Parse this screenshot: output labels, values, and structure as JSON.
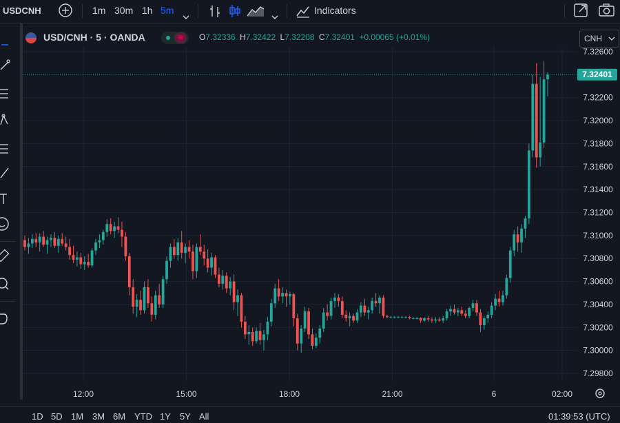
{
  "toolbar": {
    "symbol": "USDCNH",
    "intervals": [
      "1m",
      "30m",
      "1h",
      "5m"
    ],
    "active_interval": "5m",
    "indicators_label": "Indicators"
  },
  "legend": {
    "title": "USD/CNH · 5 · OANDA",
    "o_label": "O",
    "o_value": "7.32336",
    "h_label": "H",
    "h_value": "7.32422",
    "l_label": "L",
    "l_value": "7.32208",
    "c_label": "C",
    "c_value": "7.32401",
    "change": "+0.00065 (+0.01%)"
  },
  "currency_button": "CNH",
  "colors": {
    "up": "#26a69a",
    "down": "#ef5350",
    "bg": "#131722",
    "grid": "#1f2330",
    "text": "#d1d4dc",
    "accent": "#2962ff"
  },
  "price_axis": {
    "labels": [
      "7.32600",
      "7.32200",
      "7.32000",
      "7.31800",
      "7.31600",
      "7.31400",
      "7.31200",
      "7.31000",
      "7.30800",
      "7.30600",
      "7.30400",
      "7.30200",
      "7.30000",
      "7.29800"
    ],
    "current_price": "7.32401"
  },
  "time_axis": {
    "labels": [
      "12:00",
      "15:00",
      "18:00",
      "21:00",
      "6",
      "02:00"
    ]
  },
  "bottom": {
    "ranges": [
      "1D",
      "5D",
      "1M",
      "3M",
      "6M",
      "YTD",
      "1Y",
      "5Y",
      "All"
    ],
    "clock": "01:39:53 (UTC)"
  },
  "chart_data": {
    "type": "candlestick",
    "y_range": [
      7.2978,
      7.3262
    ],
    "x_ticks": [
      "12:00",
      "15:00",
      "18:00",
      "21:00",
      "6",
      "02:00"
    ],
    "last_price": 7.32401,
    "candles": [
      [
        7.3096,
        7.31,
        7.3087,
        7.309
      ],
      [
        7.309,
        7.3098,
        7.3084,
        7.3093
      ],
      [
        7.3093,
        7.3101,
        7.3089,
        7.3097
      ],
      [
        7.3097,
        7.3102,
        7.309,
        7.3094
      ],
      [
        7.3094,
        7.3102,
        7.3086,
        7.3099
      ],
      [
        7.3099,
        7.3104,
        7.309,
        7.3092
      ],
      [
        7.3092,
        7.3099,
        7.3084,
        7.3096
      ],
      [
        7.3096,
        7.3101,
        7.309,
        7.3098
      ],
      [
        7.3098,
        7.3103,
        7.3089,
        7.3091
      ],
      [
        7.3091,
        7.31,
        7.3085,
        7.3097
      ],
      [
        7.3097,
        7.3102,
        7.3091,
        7.3093
      ],
      [
        7.3093,
        7.3099,
        7.3087,
        7.309
      ],
      [
        7.309,
        7.3097,
        7.3079,
        7.3083
      ],
      [
        7.3083,
        7.3091,
        7.3076,
        7.3079
      ],
      [
        7.3079,
        7.3086,
        7.3073,
        7.3081
      ],
      [
        7.3081,
        7.3085,
        7.3071,
        7.3075
      ],
      [
        7.3075,
        7.3082,
        7.307,
        7.3077
      ],
      [
        7.3077,
        7.3084,
        7.3072,
        7.3074
      ],
      [
        7.3074,
        7.3089,
        7.3072,
        7.3087
      ],
      [
        7.3087,
        7.3097,
        7.3083,
        7.3094
      ],
      [
        7.3094,
        7.3101,
        7.3089,
        7.3096
      ],
      [
        7.3096,
        7.3105,
        7.3092,
        7.3103
      ],
      [
        7.3103,
        7.3114,
        7.3099,
        7.311
      ],
      [
        7.311,
        7.3115,
        7.3101,
        7.3104
      ],
      [
        7.3104,
        7.3112,
        7.3098,
        7.3108
      ],
      [
        7.3108,
        7.3116,
        7.3102,
        7.3105
      ],
      [
        7.3105,
        7.3112,
        7.309,
        7.3099
      ],
      [
        7.3099,
        7.3103,
        7.3078,
        7.3082
      ],
      [
        7.3082,
        7.3085,
        7.3048,
        7.3055
      ],
      [
        7.3055,
        7.3062,
        7.3032,
        7.3038
      ],
      [
        7.3038,
        7.3049,
        7.3029,
        7.3044
      ],
      [
        7.3044,
        7.3052,
        7.3031,
        7.3035
      ],
      [
        7.3035,
        7.306,
        7.3032,
        7.3055
      ],
      [
        7.3055,
        7.3062,
        7.3037,
        7.3041
      ],
      [
        7.3041,
        7.3047,
        7.3025,
        7.3031
      ],
      [
        7.3031,
        7.3052,
        7.3027,
        7.3048
      ],
      [
        7.3048,
        7.3058,
        7.3037,
        7.304
      ],
      [
        7.304,
        7.3065,
        7.3037,
        7.3062
      ],
      [
        7.3062,
        7.3082,
        7.3058,
        7.3078
      ],
      [
        7.3078,
        7.3093,
        7.3072,
        7.309
      ],
      [
        7.309,
        7.3097,
        7.308,
        7.3083
      ],
      [
        7.3083,
        7.3098,
        7.3078,
        7.3094
      ],
      [
        7.3094,
        7.3104,
        7.308,
        7.3085
      ],
      [
        7.3085,
        7.3093,
        7.3076,
        7.309
      ],
      [
        7.309,
        7.3096,
        7.308,
        7.3086
      ],
      [
        7.3086,
        7.3092,
        7.3062,
        7.3069
      ],
      [
        7.3069,
        7.3093,
        7.3063,
        7.309
      ],
      [
        7.309,
        7.3101,
        7.3083,
        7.3086
      ],
      [
        7.3086,
        7.3092,
        7.3074,
        7.308
      ],
      [
        7.308,
        7.3088,
        7.3068,
        7.3072
      ],
      [
        7.3072,
        7.3085,
        7.3065,
        7.3081
      ],
      [
        7.3081,
        7.3083,
        7.3063,
        7.3066
      ],
      [
        7.3066,
        7.3072,
        7.3055,
        7.3058
      ],
      [
        7.3058,
        7.307,
        7.3053,
        7.3065
      ],
      [
        7.3065,
        7.3068,
        7.305,
        7.3054
      ],
      [
        7.3054,
        7.3064,
        7.3048,
        7.306
      ],
      [
        7.306,
        7.3066,
        7.3035,
        7.3042
      ],
      [
        7.3042,
        7.3053,
        7.303,
        7.3048
      ],
      [
        7.3048,
        7.305,
        7.302,
        7.3025
      ],
      [
        7.3025,
        7.303,
        7.301,
        7.3014
      ],
      [
        7.3014,
        7.3022,
        7.3005,
        7.3016
      ],
      [
        7.3016,
        7.302,
        7.3004,
        7.3008
      ],
      [
        7.3008,
        7.302,
        7.3006,
        7.3017
      ],
      [
        7.3017,
        7.3024,
        7.3005,
        7.3009
      ],
      [
        7.3009,
        7.3018,
        7.3,
        7.3014
      ],
      [
        7.3014,
        7.3029,
        7.3009,
        7.3025
      ],
      [
        7.3025,
        7.3045,
        7.3021,
        7.3041
      ],
      [
        7.3041,
        7.3058,
        7.3037,
        7.3054
      ],
      [
        7.3054,
        7.3062,
        7.3043,
        7.3047
      ],
      [
        7.3047,
        7.3055,
        7.3041,
        7.305
      ],
      [
        7.305,
        7.3053,
        7.3038,
        7.3047
      ],
      [
        7.3047,
        7.3051,
        7.304,
        7.3049
      ],
      [
        7.3049,
        7.305,
        7.3021,
        7.3028
      ],
      [
        7.3028,
        7.3032,
        7.3,
        7.3006
      ],
      [
        7.3006,
        7.3022,
        7.2998,
        7.3019
      ],
      [
        7.3019,
        7.3038,
        7.3016,
        7.3034
      ],
      [
        7.3034,
        7.3037,
        7.301,
        7.3014
      ],
      [
        7.3014,
        7.3019,
        7.3001,
        7.3004
      ],
      [
        7.3004,
        7.3015,
        7.3002,
        7.3011
      ],
      [
        7.3011,
        7.3022,
        7.3006,
        7.3019
      ],
      [
        7.3019,
        7.3037,
        7.3016,
        7.3033
      ],
      [
        7.3033,
        7.304,
        7.3026,
        7.303
      ],
      [
        7.303,
        7.3046,
        7.3027,
        7.3043
      ],
      [
        7.3043,
        7.305,
        7.3037,
        7.3046
      ],
      [
        7.3046,
        7.3049,
        7.3038,
        7.3043
      ],
      [
        7.3043,
        7.3047,
        7.3028,
        7.3031
      ],
      [
        7.3031,
        7.3035,
        7.3025,
        7.3028
      ],
      [
        7.3028,
        7.3033,
        7.3021,
        7.303
      ],
      [
        7.303,
        7.3032,
        7.3024,
        7.3026
      ],
      [
        7.3026,
        7.3036,
        7.3024,
        7.3033
      ],
      [
        7.3033,
        7.3042,
        7.3029,
        7.3039
      ],
      [
        7.3039,
        7.3045,
        7.303,
        7.3033
      ],
      [
        7.3033,
        7.3038,
        7.3027,
        7.3035
      ],
      [
        7.3035,
        7.3046,
        7.3032,
        7.3043
      ],
      [
        7.3043,
        7.305,
        7.3038,
        7.3041
      ],
      [
        7.3041,
        7.3048,
        7.3032,
        7.3046
      ],
      [
        7.3046,
        7.3048,
        7.3028,
        7.303
      ],
      [
        7.303,
        7.3031,
        7.3028,
        7.3029
      ],
      [
        7.3029,
        7.303,
        7.3028,
        7.3029
      ],
      [
        7.3029,
        7.303,
        7.3028,
        7.3029
      ],
      [
        7.3029,
        7.303,
        7.3028,
        7.3029
      ],
      [
        7.3029,
        7.303,
        7.3028,
        7.3029
      ],
      [
        7.3029,
        7.303,
        7.3028,
        7.3029
      ],
      [
        7.3029,
        7.303,
        7.3027,
        7.3028
      ],
      [
        7.3028,
        7.3029,
        7.3027,
        7.3028
      ],
      [
        7.3028,
        7.3029,
        7.3027,
        7.3028
      ],
      [
        7.3028,
        7.3029,
        7.3024,
        7.3026
      ],
      [
        7.3026,
        7.3029,
        7.3025,
        7.3028
      ],
      [
        7.3028,
        7.303,
        7.3025,
        7.3027
      ],
      [
        7.3027,
        7.3029,
        7.3024,
        7.3026
      ],
      [
        7.3026,
        7.3029,
        7.3024,
        7.3027
      ],
      [
        7.3027,
        7.3029,
        7.3025,
        7.3026
      ],
      [
        7.3026,
        7.303,
        7.3024,
        7.3028
      ],
      [
        7.3028,
        7.3036,
        7.3026,
        7.3034
      ],
      [
        7.3034,
        7.3039,
        7.303,
        7.3036
      ],
      [
        7.3036,
        7.304,
        7.3031,
        7.3033
      ],
      [
        7.3033,
        7.3037,
        7.303,
        7.3035
      ],
      [
        7.3035,
        7.3038,
        7.303,
        7.3032
      ],
      [
        7.3032,
        7.3035,
        7.3028,
        7.303
      ],
      [
        7.303,
        7.3038,
        7.3028,
        7.3037
      ],
      [
        7.3037,
        7.3044,
        7.3034,
        7.3041
      ],
      [
        7.3041,
        7.3044,
        7.303,
        7.3033
      ],
      [
        7.3033,
        7.3036,
        7.3016,
        7.3022
      ],
      [
        7.3022,
        7.303,
        7.3018,
        7.3028
      ],
      [
        7.3028,
        7.3034,
        7.3024,
        7.3031
      ],
      [
        7.3031,
        7.3042,
        7.3028,
        7.3039
      ],
      [
        7.3039,
        7.3049,
        7.3035,
        7.3045
      ],
      [
        7.3045,
        7.3052,
        7.3038,
        7.3042
      ],
      [
        7.3042,
        7.3052,
        7.3039,
        7.3048
      ],
      [
        7.3048,
        7.3066,
        7.3045,
        7.3063
      ],
      [
        7.3063,
        7.309,
        7.3059,
        7.3087
      ],
      [
        7.3087,
        7.3105,
        7.3082,
        7.3101
      ],
      [
        7.3101,
        7.3108,
        7.3086,
        7.3094
      ],
      [
        7.3094,
        7.311,
        7.3085,
        7.3106
      ],
      [
        7.3106,
        7.3117,
        7.3098,
        7.3115
      ],
      [
        7.3115,
        7.318,
        7.311,
        7.3174
      ],
      [
        7.3174,
        7.324,
        7.3168,
        7.3232
      ],
      [
        7.3232,
        7.325,
        7.3159,
        7.3168
      ],
      [
        7.3168,
        7.3238,
        7.316,
        7.3181
      ],
      [
        7.3181,
        7.3252,
        7.3176,
        7.3236
      ],
      [
        7.3236,
        7.3242,
        7.3221,
        7.324
      ]
    ]
  }
}
